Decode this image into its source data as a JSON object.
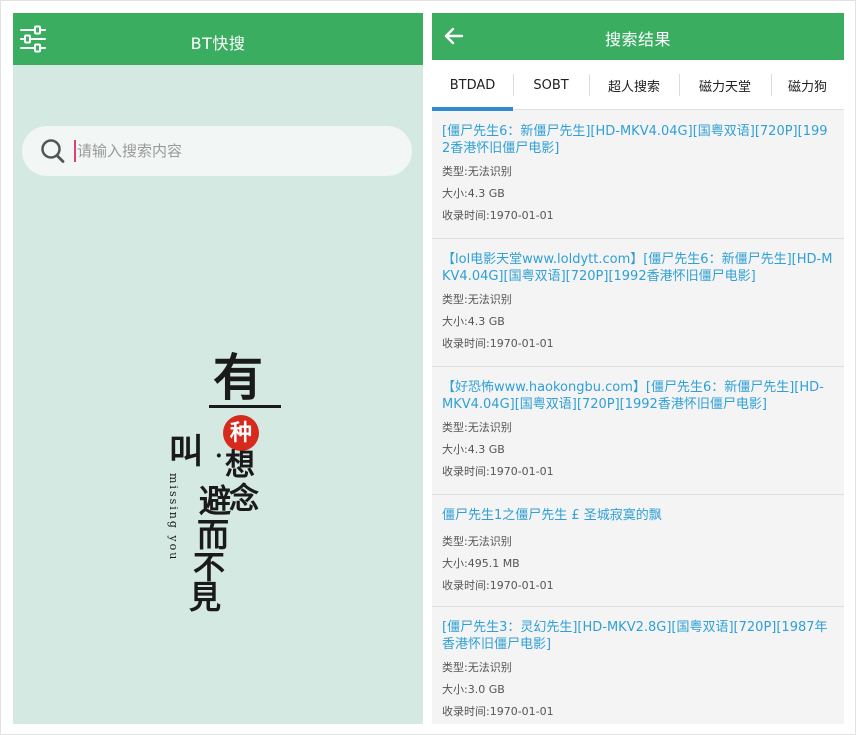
{
  "left": {
    "title": "BT快搜",
    "search": {
      "placeholder": "请输入搜索内容",
      "value": ""
    },
    "art": {
      "you": "有",
      "seal": "种",
      "xiang": "想",
      "nian": "念",
      "jiao": "叫",
      "dot": "·",
      "bi": "避",
      "er": "而",
      "bu": "不",
      "jian": "見",
      "english": "missing you"
    }
  },
  "right": {
    "title": "搜索结果",
    "tabs": [
      {
        "label": "BTDAD",
        "active": true
      },
      {
        "label": "SOBT",
        "active": false
      },
      {
        "label": "超人搜索",
        "active": false
      },
      {
        "label": "磁力天堂",
        "active": false
      },
      {
        "label": "磁力狗",
        "active": false
      }
    ],
    "results": [
      {
        "title": "[僵尸先生6：新僵尸先生][HD-MKV4.04G][国粤双语][720P][1992香港怀旧僵尸电影]",
        "type": "类型:无法识别",
        "size": "大小:4.3 GB",
        "time": "收录时间:1970-01-01"
      },
      {
        "title": "【lol电影天堂www.loldytt.com】[僵尸先生6：新僵尸先生][HD-MKV4.04G][国粤双语][720P][1992香港怀旧僵尸电影]",
        "type": "类型:无法识别",
        "size": "大小:4.3 GB",
        "time": "收录时间:1970-01-01"
      },
      {
        "title": "【好恐怖www.haokongbu.com】[僵尸先生6：新僵尸先生][HD-MKV4.04G][国粤双语][720P][1992香港怀旧僵尸电影]",
        "type": "类型:无法识别",
        "size": "大小:4.3 GB",
        "time": "收录时间:1970-01-01"
      },
      {
        "title": "僵尸先生1之僵尸先生 £ 圣城寂寞的飘",
        "type": "类型:无法识别",
        "size": "大小:495.1 MB",
        "time": "收录时间:1970-01-01"
      },
      {
        "title": "[僵尸先生3：灵幻先生][HD-MKV2.8G][国粤双语][720P][1987年香港怀旧僵尸电影]",
        "type": "类型:无法识别",
        "size": "大小:3.0 GB",
        "time": "收录时间:1970-01-01"
      }
    ]
  },
  "colors": {
    "appbar": "#3aad60",
    "left_background": "#d4e9e2",
    "link": "#2fa0d6",
    "tab_indicator": "#2f8ad0",
    "seal": "#d62a1f"
  },
  "icons": {
    "menu": "sliders-icon",
    "back": "arrow-left-icon",
    "search": "search-icon"
  }
}
